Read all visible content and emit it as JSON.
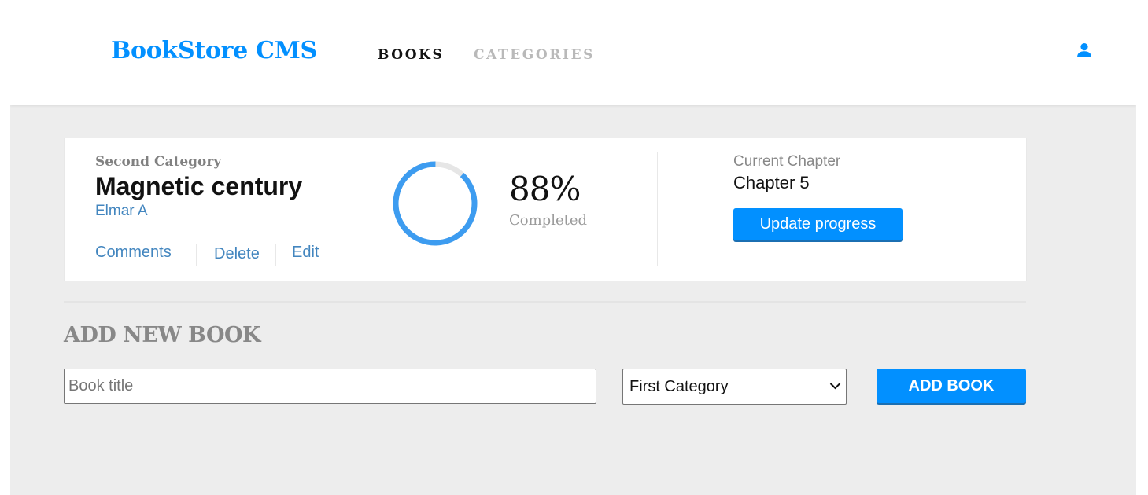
{
  "brand": {
    "name": "BookStore CMS",
    "accent_color": "#0290ff"
  },
  "nav": {
    "links": [
      {
        "label": "BOOKS",
        "active": true
      },
      {
        "label": "CATEGORIES",
        "active": false
      }
    ],
    "user_icon": "user-icon"
  },
  "book": {
    "category": "Second Category",
    "title": "Magnetic century",
    "author": "Elmar A",
    "actions": {
      "comments": "Comments",
      "delete": "Delete",
      "edit": "Edit"
    },
    "progress": {
      "percent": 88,
      "percent_text": "88%",
      "label": "Completed",
      "ring_color": "#3d9cf0",
      "track_color": "#e6e6e6"
    },
    "chapter": {
      "label": "Current Chapter",
      "value": "Chapter 5",
      "button_label": "Update progress"
    }
  },
  "add_book_form": {
    "title": "ADD NEW BOOK",
    "title_input": {
      "value": "",
      "placeholder": "Book title"
    },
    "category_select": {
      "selected": "First Category"
    },
    "submit_label": "ADD BOOK"
  }
}
